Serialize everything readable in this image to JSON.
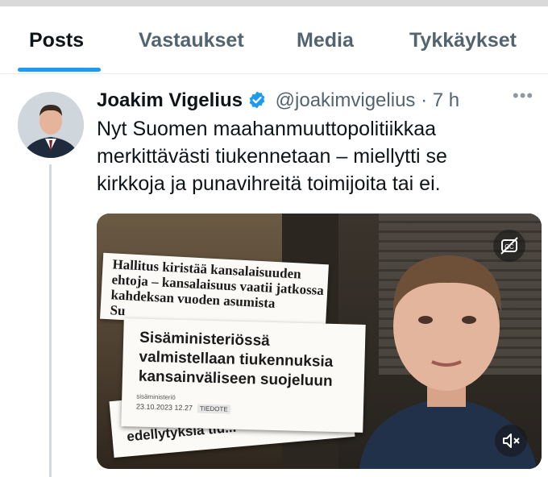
{
  "tabs": [
    {
      "label": "Posts",
      "active": true
    },
    {
      "label": "Vastaukset",
      "active": false
    },
    {
      "label": "Media",
      "active": false
    },
    {
      "label": "Tykkäykset",
      "active": false
    }
  ],
  "colors": {
    "accent": "#1d9bf0",
    "text": "#0f1419",
    "muted": "#536471"
  },
  "post": {
    "author": "Joakim Vigelius",
    "handle": "@joakimvigelius",
    "separator": "·",
    "time": "7 h",
    "more_icon": "more-dots-icon",
    "verified_icon": "verified-badge-icon",
    "text_lines": [
      "Nyt Suomen maahanmuuttopolitiikkaa",
      "merkittävästi tiukennetaan – miellytti se",
      "kirkkoja ja punavihreitä toimijoita tai ei."
    ],
    "media": {
      "clipping1": [
        "Hallitus kiristää kansalaisuuden",
        "ehtoja – kansalaisuus vaatii jatkossa",
        "kahdeksan vuoden asumista",
        "Su"
      ],
      "clipping2_headline": [
        "Sisäministeriössä",
        "valmistellaan tiukennuksia",
        "kansainväliseen suojeluun"
      ],
      "clipping2_source": "sisäministeriö",
      "clipping2_date": "23.10.2023 12.27",
      "clipping2_tag": "TIEDOTE",
      "clipping3": "edellytyksiä tiu...",
      "captions_icon": "closed-captions-off-icon",
      "mute_icon": "speaker-muted-icon"
    }
  }
}
